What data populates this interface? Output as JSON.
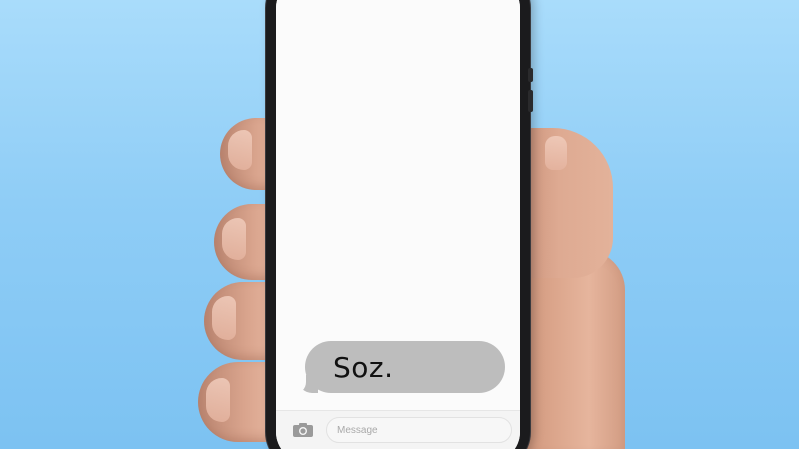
{
  "background": {
    "color_top": "#a9dcfb",
    "color_bottom": "#7cc2f2"
  },
  "phone": {
    "screen_color": "#fbfbfb",
    "frame_color": "#1b1b1d"
  },
  "conversation": {
    "messages": [
      {
        "direction": "received",
        "text": "Soz.",
        "bubble_color": "#bdbdbd"
      }
    ]
  },
  "compose": {
    "camera_icon": "camera-icon",
    "placeholder": "Message"
  }
}
